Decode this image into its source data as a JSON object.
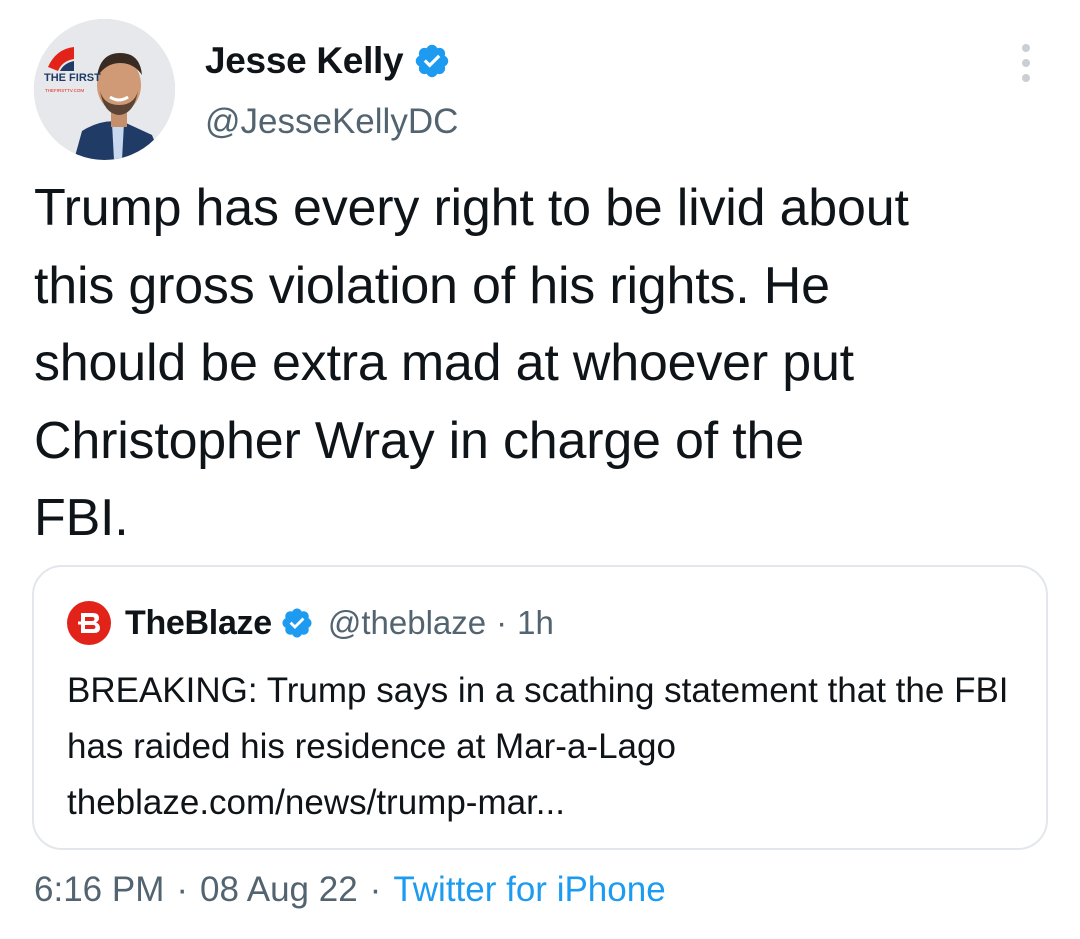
{
  "author": {
    "name": "Jesse Kelly",
    "handle": "@JesseKellyDC",
    "avatar_logo_text": "THE FIRST",
    "avatar_logo_sub": "THEFIRSTTV.COM"
  },
  "tweet": {
    "text": "Trump has every right to be livid about\nthis gross violation of his rights. He\nshould be extra mad at whoever put\nChristopher Wray in charge of the\nFBI."
  },
  "quote": {
    "name": "TheBlaze",
    "handle": "@theblaze",
    "separator": "·",
    "time": "1h",
    "text": "BREAKING: Trump says in a scathing statement that the FBI has raided his residence at Mar-a-Lago",
    "link": "theblaze.com/news/trump-mar..."
  },
  "meta": {
    "time": "6:16 PM",
    "sep1": "·",
    "date": "08 Aug 22",
    "sep2": "·",
    "source": "Twitter for iPhone"
  },
  "colors": {
    "accent": "#1d9bf0",
    "verified": "#1d9bf0",
    "muted": "#536471",
    "text": "#0f1419",
    "blaze_red": "#e2231a"
  },
  "icons": {
    "verified": "verified-badge-icon",
    "more": "more-options-icon",
    "blaze": "theblaze-logo-icon"
  }
}
